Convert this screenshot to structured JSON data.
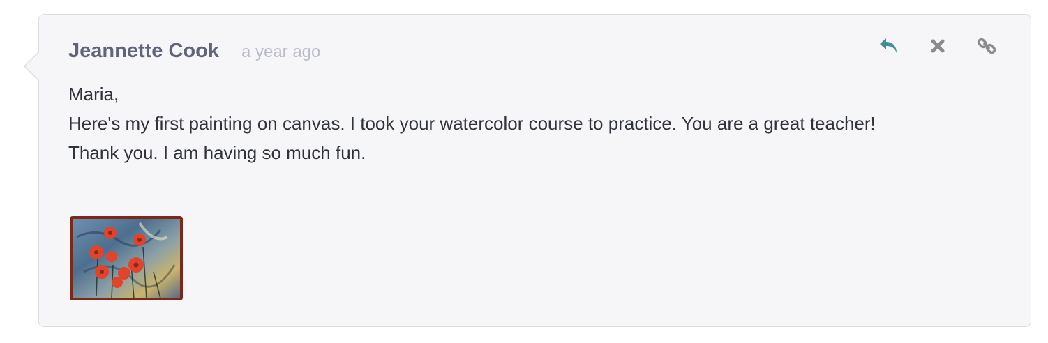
{
  "comment": {
    "author": "Jeannette Cook",
    "timestamp": "a year ago",
    "body_lines": [
      "Maria,",
      "Here's my first painting on canvas. I took your watercolor course to practice. You are a great teacher!",
      "Thank you. I am having so much fun."
    ],
    "actions": [
      {
        "name": "reply",
        "icon": "reply-icon",
        "color": "#3f8f96"
      },
      {
        "name": "delete",
        "icon": "close-icon",
        "color": "#8a8a8f"
      },
      {
        "name": "permalink",
        "icon": "link-icon",
        "color": "#8a8a8f"
      }
    ],
    "attachment": {
      "icon": "painting-thumbnail",
      "colors": {
        "background": "#5b7fa0",
        "flowers": "#e0442a",
        "border": "#7a2a1a"
      }
    }
  }
}
